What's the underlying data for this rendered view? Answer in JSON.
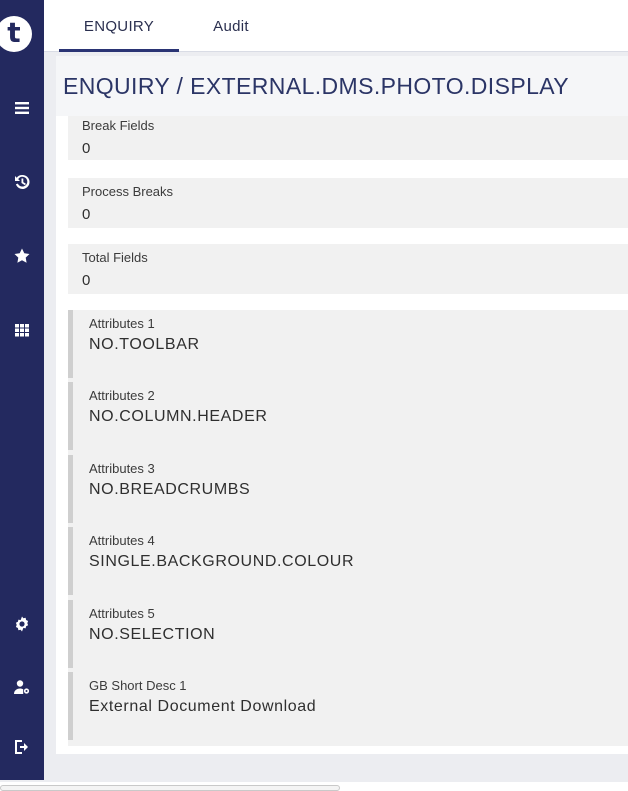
{
  "sidebar": {
    "logo_text": "t",
    "icons": [
      "menu-icon",
      "history-icon",
      "star-icon",
      "apps-grid-icon",
      "settings-icon",
      "user-settings-icon",
      "logout-icon"
    ]
  },
  "tabs": [
    {
      "label": "ENQUIRY",
      "active": true
    },
    {
      "label": "Audit",
      "active": false
    }
  ],
  "page_title": "ENQUIRY / EXTERNAL.DMS.PHOTO.DISPLAY",
  "fields": [
    {
      "label": "Break Fields",
      "value": "0"
    },
    {
      "label": "Process Breaks",
      "value": "0"
    },
    {
      "label": "Total Fields",
      "value": "0"
    }
  ],
  "attributes": [
    {
      "label": "Attributes 1",
      "value": "NO.TOOLBAR"
    },
    {
      "label": "Attributes 2",
      "value": "NO.COLUMN.HEADER"
    },
    {
      "label": "Attributes 3",
      "value": "NO.BREADCRUMBS"
    },
    {
      "label": "Attributes 4",
      "value": "SINGLE.BACKGROUND.COLOUR"
    },
    {
      "label": "Attributes 5",
      "value": "NO.SELECTION"
    },
    {
      "label": "GB Short Desc 1",
      "value": "External Document Download"
    }
  ],
  "colors": {
    "sidebar": "#23295f",
    "title": "#2b3566",
    "field_bg": "#f1f1f1",
    "page_bg": "#ecedf1"
  }
}
